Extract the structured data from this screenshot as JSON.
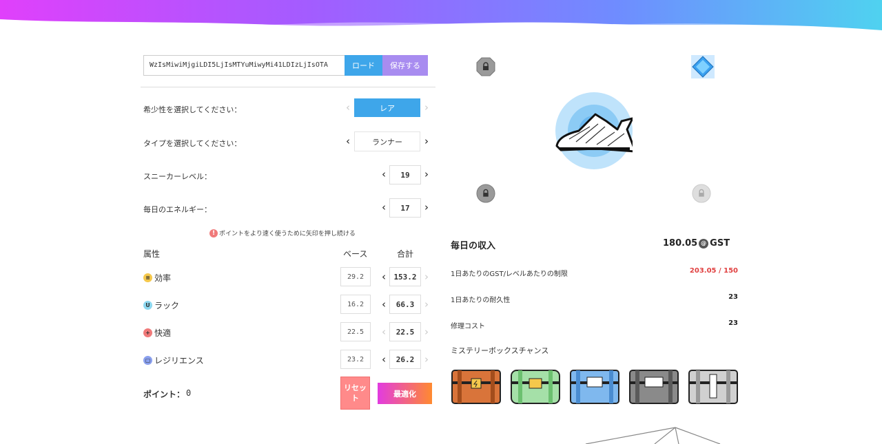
{
  "toolbar": {
    "code_value": "WzIsMiwiMjgiLDI5LjIsMTYuMiwyMi41LDIzLjIsOTA",
    "load_label": "ロード",
    "save_label": "保存する"
  },
  "selectors": {
    "rarity_label": "希少性を選択してください：",
    "rarity_value": "レア",
    "type_label": "タイプを選択してください：",
    "type_value": "ランナー",
    "level_label": "スニーカーレベル：",
    "level_value": "19",
    "energy_label": "毎日のエネルギー：",
    "energy_value": "17"
  },
  "note": {
    "icon": "warning-icon",
    "text": "ポイントをより速く使うために矢印を押し続ける"
  },
  "attributes": {
    "header_attr": "属性",
    "header_base": "ベース",
    "header_total": "合計",
    "items": [
      {
        "name": "効率",
        "icon": "efficiency-icon",
        "icon_glyph": "≡",
        "color": "#f5c84c",
        "base": "29.2",
        "total": "153.2"
      },
      {
        "name": "ラック",
        "icon": "luck-icon",
        "icon_glyph": "U",
        "color": "#8ed8f0",
        "base": "16.2",
        "total": "66.3"
      },
      {
        "name": "快適",
        "icon": "comfort-icon",
        "icon_glyph": "+",
        "color": "#f07a7a",
        "base": "22.5",
        "total": "22.5"
      },
      {
        "name": "レジリエンス",
        "icon": "resilience-icon",
        "icon_glyph": "▢",
        "color": "#8aa0ee",
        "base": "23.2",
        "total": "26.2"
      }
    ]
  },
  "points": {
    "label": "ポイント：",
    "value": "0"
  },
  "actions": {
    "reset_label": "リセット",
    "optimize_label": "最適化"
  },
  "earnings": {
    "title": "毎日の収入",
    "value": "180.05",
    "unit": "GST",
    "gst_limit_label": "1日あたりのGST/レベルあたりの制限",
    "gst_limit_value": "203.05 / 150",
    "durability_label": "1日あたりの耐久性",
    "durability_value": "23",
    "repair_label": "修理コスト",
    "repair_value": "23",
    "mystery_label": "ミステリーボックスチャンス"
  },
  "colors": {
    "accent_blue": "#3ea6ea",
    "accent_purple": "#a88cf0",
    "limit_red": "#e04040"
  }
}
